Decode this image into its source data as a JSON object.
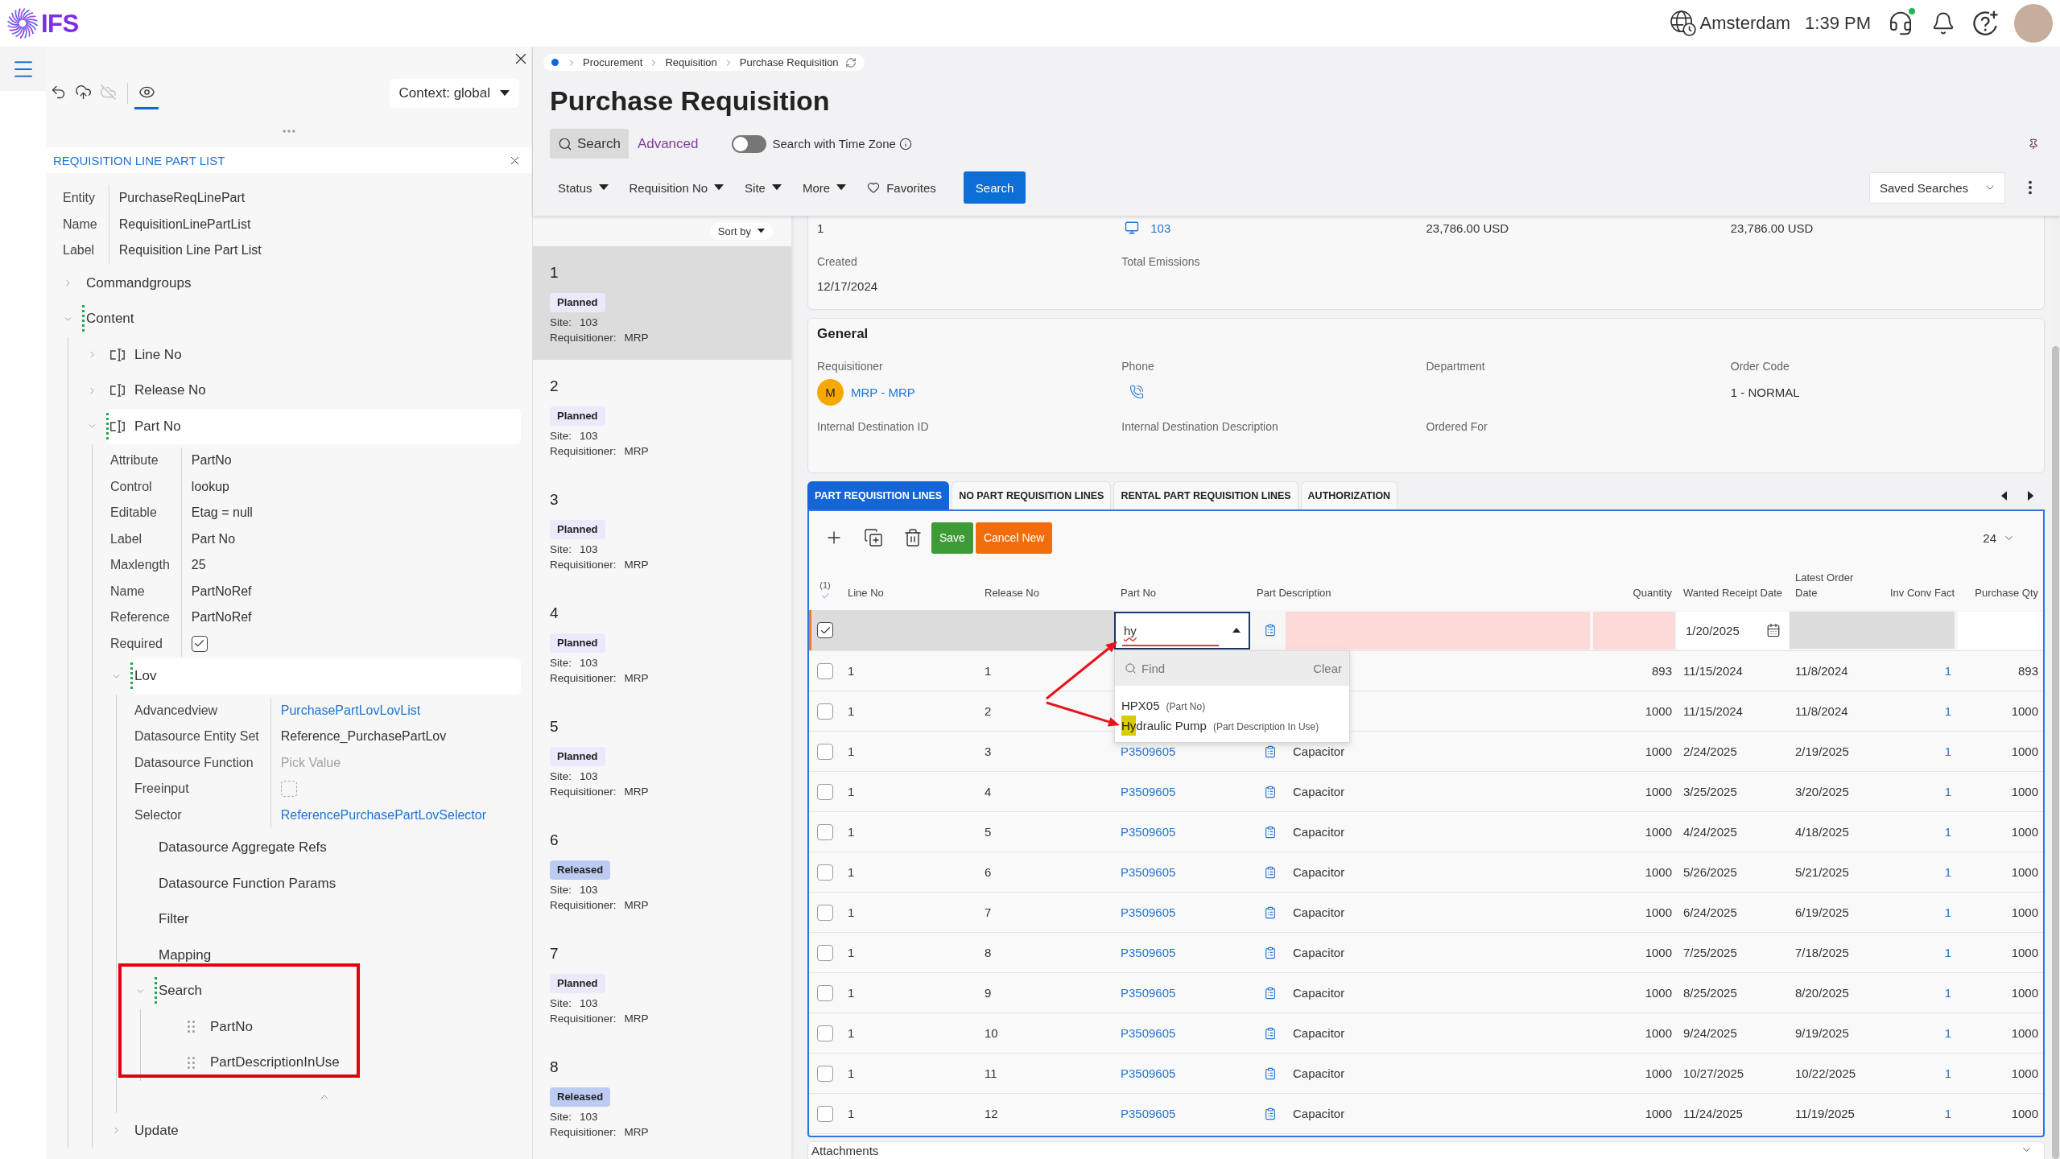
{
  "top_bar": {
    "logo_text": "IFS",
    "location": "Amsterdam",
    "time": "1:39 PM",
    "icons": [
      {
        "kind": "support",
        "badge": true
      },
      {
        "kind": "notifications",
        "badge": false
      },
      {
        "kind": "help",
        "badge": false
      }
    ]
  },
  "designer": {
    "toolbar": [
      {
        "kind": "undo",
        "disabled": false,
        "selected": false
      },
      {
        "kind": "publish",
        "disabled": false,
        "selected": false
      },
      {
        "kind": "discard",
        "disabled": true,
        "selected": false
      },
      {
        "kind": "preview",
        "disabled": false,
        "selected": true
      }
    ],
    "context": "Context: global",
    "panel_title": "REQUISITION LINE PART LIST",
    "properties": [
      {
        "label": "Entity",
        "kind": "text",
        "value": "PurchaseReqLinePart"
      },
      {
        "label": "Name",
        "kind": "text",
        "value": "RequisitionLinePartList"
      },
      {
        "label": "Label",
        "kind": "text",
        "value": "Requisition Line Part List"
      }
    ],
    "tree": [
      {
        "label": "Commandgroups",
        "expanded": false,
        "selected": false
      },
      {
        "label": "Content",
        "expanded": true,
        "selected": false,
        "children": [
          {
            "label": "Line No",
            "kind": "field",
            "expanded": false,
            "selected": false
          },
          {
            "label": "Release No",
            "kind": "field",
            "expanded": false,
            "selected": false
          },
          {
            "label": "Part No",
            "kind": "field",
            "expanded": true,
            "selected": true,
            "properties": [
              {
                "label": "Attribute",
                "kind": "text",
                "value": "PartNo"
              },
              {
                "label": "Control",
                "kind": "text",
                "value": "lookup"
              },
              {
                "label": "Editable",
                "kind": "text",
                "value": "Etag = null"
              },
              {
                "label": "Label",
                "kind": "text",
                "value": "Part No"
              },
              {
                "label": "Maxlength",
                "kind": "text",
                "value": "25"
              },
              {
                "label": "Name",
                "kind": "text",
                "value": "PartNoRef"
              },
              {
                "label": "Reference",
                "kind": "text",
                "value": "PartNoRef"
              },
              {
                "label": "Required",
                "kind": "checkbox",
                "checked": true
              }
            ],
            "children": [
              {
                "label": "Lov",
                "expanded": true,
                "selected": true,
                "collapsible": true,
                "properties": [
                  {
                    "label": "Advancedview",
                    "kind": "link",
                    "value": "PurchasePartLovLovList"
                  },
                  {
                    "label": "Datasource Entity Set",
                    "kind": "text",
                    "value": "Reference_PurchasePartLov"
                  },
                  {
                    "label": "Datasource Function",
                    "kind": "input",
                    "placeholder": "Pick Value"
                  },
                  {
                    "label": "Freeinput",
                    "kind": "checkbox",
                    "checked": false
                  },
                  {
                    "label": "Selector",
                    "kind": "link",
                    "value": "ReferencePurchasePartLovSelector"
                  }
                ],
                "children": [
                  {
                    "label": "Datasource Aggregate Refs",
                    "selected": false
                  },
                  {
                    "label": "Datasource Function Params",
                    "selected": false
                  },
                  {
                    "label": "Filter",
                    "selected": false
                  },
                  {
                    "label": "Mapping",
                    "selected": false
                  },
                  {
                    "label": "Search",
                    "expanded": true,
                    "selected": false,
                    "annotated": true,
                    "children": [
                      {
                        "label": "PartNo",
                        "kind": "draggable",
                        "selected": false
                      },
                      {
                        "label": "PartDescriptionInUse",
                        "kind": "draggable",
                        "selected": false
                      }
                    ]
                  }
                ]
              },
              {
                "label": "Update",
                "expanded": false,
                "selected": false
              }
            ]
          }
        ]
      }
    ]
  },
  "page": {
    "breadcrumb": [
      "Procurement",
      "Requisition",
      "Purchase Requisition"
    ],
    "title": "Purchase Requisition",
    "search_modes": [
      {
        "label": "Search",
        "kind": "basic",
        "selected": true
      },
      {
        "label": "Advanced",
        "kind": "advanced",
        "selected": false
      }
    ],
    "time_zone": {
      "label": "Search with Time Zone",
      "on": false
    },
    "filters": [
      "Status",
      "Requisition No",
      "Site",
      "More"
    ],
    "favorites": "Favorites",
    "search_button": "Search",
    "saved_searches": "Saved Searches"
  },
  "requisition_list": {
    "sort_label": "Sort by",
    "items": [
      {
        "number": "1",
        "status": "Planned",
        "color": "#ebe9fb",
        "site_label": "Site:",
        "site": "103",
        "requisitioner_label": "Requisitioner:",
        "requisitioner": "MRP",
        "selected": true
      },
      {
        "number": "2",
        "status": "Planned",
        "color": "#ebe9fb",
        "site_label": "Site:",
        "site": "103",
        "requisitioner_label": "Requisitioner:",
        "requisitioner": "MRP",
        "selected": false
      },
      {
        "number": "3",
        "status": "Planned",
        "color": "#ebe9fb",
        "site_label": "Site:",
        "site": "103",
        "requisitioner_label": "Requisitioner:",
        "requisitioner": "MRP",
        "selected": false
      },
      {
        "number": "4",
        "status": "Planned",
        "color": "#ebe9fb",
        "site_label": "Site:",
        "site": "103",
        "requisitioner_label": "Requisitioner:",
        "requisitioner": "MRP",
        "selected": false
      },
      {
        "number": "5",
        "status": "Planned",
        "color": "#ebe9fb",
        "site_label": "Site:",
        "site": "103",
        "requisitioner_label": "Requisitioner:",
        "requisitioner": "MRP",
        "selected": false
      },
      {
        "number": "6",
        "status": "Released",
        "color": "#bccbf1",
        "site_label": "Site:",
        "site": "103",
        "requisitioner_label": "Requisitioner:",
        "requisitioner": "MRP",
        "selected": false
      },
      {
        "number": "7",
        "status": "Planned",
        "color": "#ebe9fb",
        "site_label": "Site:",
        "site": "103",
        "requisitioner_label": "Requisitioner:",
        "requisitioner": "MRP",
        "selected": false
      },
      {
        "number": "8",
        "status": "Released",
        "color": "#bccbf1",
        "site_label": "Site:",
        "site": "103",
        "requisitioner_label": "Requisitioner:",
        "requisitioner": "MRP",
        "selected": false
      }
    ]
  },
  "summary": {
    "values": [
      {
        "kind": "text",
        "text": "1"
      },
      {
        "kind": "link",
        "text": "103"
      },
      {
        "kind": "text",
        "text": "23,786.00 USD"
      },
      {
        "kind": "text",
        "text": "23,786.00 USD"
      }
    ],
    "fields": [
      {
        "label": "Created",
        "value": "12/17/2024"
      },
      {
        "label": "Total Emissions"
      }
    ]
  },
  "general": {
    "title": "General",
    "fields": [
      {
        "label": "Requisitioner",
        "kind": "person",
        "initial": "M",
        "value": "MRP - MRP"
      },
      {
        "label": "Phone",
        "kind": "phone"
      },
      {
        "label": "Department",
        "kind": "text"
      },
      {
        "label": "Order Code",
        "kind": "text",
        "value": "1 - NORMAL"
      },
      {
        "label": "Internal Destination ID",
        "kind": "text"
      },
      {
        "label": "Internal Destination Description",
        "kind": "text"
      },
      {
        "label": "Ordered For",
        "kind": "text"
      }
    ]
  },
  "tabs": [
    {
      "label": "PART REQUISITION LINES",
      "selected": true
    },
    {
      "label": "NO PART REQUISITION LINES",
      "selected": false
    },
    {
      "label": "RENTAL PART REQUISITION LINES",
      "selected": false
    },
    {
      "label": "AUTHORIZATION",
      "selected": false
    }
  ],
  "lines": {
    "actions": [
      {
        "label": "Save",
        "kind": "save"
      },
      {
        "label": "Cancel New",
        "kind": "cancel"
      }
    ],
    "page_size": "24",
    "selection_count": "(1)",
    "columns": [
      "Line No",
      "Release No",
      "Part No",
      "Part Description",
      "Quantity",
      "Wanted Receipt Date",
      "Latest Order Date",
      "Inv Conv Fact",
      "Purchase Qty"
    ],
    "edit_row": {
      "checked": true,
      "part_no": "hy",
      "wanted_receipt_date": "1/20/2025",
      "annotated": true
    },
    "lookup": {
      "placeholder": "Find",
      "clear": "Clear",
      "options": [
        {
          "text": "HPX05",
          "source": "(Part No)"
        },
        {
          "match": "Hy",
          "text": "draulic Pump",
          "source": "(Part Description In Use)",
          "annotated": true
        }
      ]
    },
    "rows": [
      {
        "checked": false,
        "line_no": "1",
        "release_no": "1",
        "quantity": "893",
        "wanted_receipt_date": "11/15/2024",
        "latest_order_date": "11/8/2024",
        "inv_conv_fact": "1",
        "purchase_qty": "893"
      },
      {
        "checked": false,
        "line_no": "1",
        "release_no": "2",
        "quantity": "1000",
        "wanted_receipt_date": "11/15/2024",
        "latest_order_date": "11/8/2024",
        "inv_conv_fact": "1",
        "purchase_qty": "1000"
      },
      {
        "checked": false,
        "line_no": "1",
        "release_no": "3",
        "part_no": "P3509605",
        "description": "Capacitor",
        "quantity": "1000",
        "wanted_receipt_date": "2/24/2025",
        "latest_order_date": "2/19/2025",
        "inv_conv_fact": "1",
        "purchase_qty": "1000"
      },
      {
        "checked": false,
        "line_no": "1",
        "release_no": "4",
        "part_no": "P3509605",
        "description": "Capacitor",
        "quantity": "1000",
        "wanted_receipt_date": "3/25/2025",
        "latest_order_date": "3/20/2025",
        "inv_conv_fact": "1",
        "purchase_qty": "1000"
      },
      {
        "checked": false,
        "line_no": "1",
        "release_no": "5",
        "part_no": "P3509605",
        "description": "Capacitor",
        "quantity": "1000",
        "wanted_receipt_date": "4/24/2025",
        "latest_order_date": "4/18/2025",
        "inv_conv_fact": "1",
        "purchase_qty": "1000"
      },
      {
        "checked": false,
        "line_no": "1",
        "release_no": "6",
        "part_no": "P3509605",
        "description": "Capacitor",
        "quantity": "1000",
        "wanted_receipt_date": "5/26/2025",
        "latest_order_date": "5/21/2025",
        "inv_conv_fact": "1",
        "purchase_qty": "1000"
      },
      {
        "checked": false,
        "line_no": "1",
        "release_no": "7",
        "part_no": "P3509605",
        "description": "Capacitor",
        "quantity": "1000",
        "wanted_receipt_date": "6/24/2025",
        "latest_order_date": "6/19/2025",
        "inv_conv_fact": "1",
        "purchase_qty": "1000"
      },
      {
        "checked": false,
        "line_no": "1",
        "release_no": "8",
        "part_no": "P3509605",
        "description": "Capacitor",
        "quantity": "1000",
        "wanted_receipt_date": "7/25/2025",
        "latest_order_date": "7/18/2025",
        "inv_conv_fact": "1",
        "purchase_qty": "1000"
      },
      {
        "checked": false,
        "line_no": "1",
        "release_no": "9",
        "part_no": "P3509605",
        "description": "Capacitor",
        "quantity": "1000",
        "wanted_receipt_date": "8/25/2025",
        "latest_order_date": "8/20/2025",
        "inv_conv_fact": "1",
        "purchase_qty": "1000"
      },
      {
        "checked": false,
        "line_no": "1",
        "release_no": "10",
        "part_no": "P3509605",
        "description": "Capacitor",
        "quantity": "1000",
        "wanted_receipt_date": "9/24/2025",
        "latest_order_date": "9/19/2025",
        "inv_conv_fact": "1",
        "purchase_qty": "1000"
      },
      {
        "checked": false,
        "line_no": "1",
        "release_no": "11",
        "part_no": "P3509605",
        "description": "Capacitor",
        "quantity": "1000",
        "wanted_receipt_date": "10/27/2025",
        "latest_order_date": "10/22/2025",
        "inv_conv_fact": "1",
        "purchase_qty": "1000"
      },
      {
        "checked": false,
        "line_no": "1",
        "release_no": "12",
        "part_no": "P3509605",
        "description": "Capacitor",
        "quantity": "1000",
        "wanted_receipt_date": "11/24/2025",
        "latest_order_date": "11/19/2025",
        "inv_conv_fact": "1",
        "purchase_qty": "1000"
      }
    ]
  },
  "attachments": {
    "title": "Attachments"
  }
}
